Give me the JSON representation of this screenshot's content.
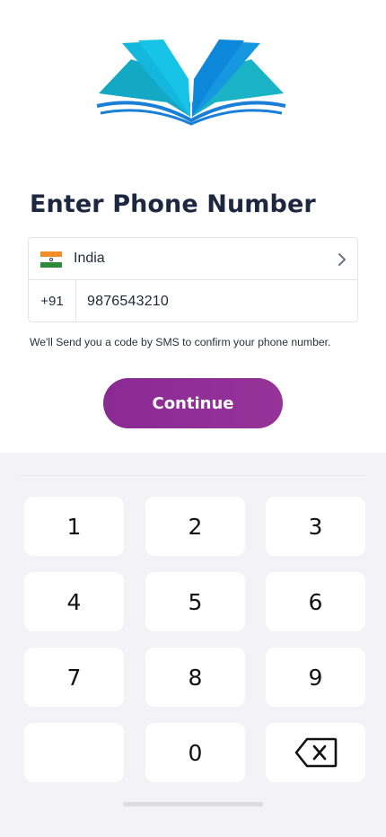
{
  "title": "Enter Phone Number",
  "country": {
    "name": "India",
    "flag_colors": [
      "#f28c28",
      "#ffffff",
      "#2e8b3a"
    ]
  },
  "phone": {
    "dial_code": "+91",
    "number": "9876543210"
  },
  "hint": "We'll Send you a code by SMS to confirm your phone number.",
  "continue_label": "Continue",
  "accent_color": "#8a2a93",
  "keypad": {
    "k1": "1",
    "k2": "2",
    "k3": "3",
    "k4": "4",
    "k5": "5",
    "k6": "6",
    "k7": "7",
    "k8": "8",
    "k9": "9",
    "k0": "0",
    "delete_icon": "backspace-icon"
  }
}
